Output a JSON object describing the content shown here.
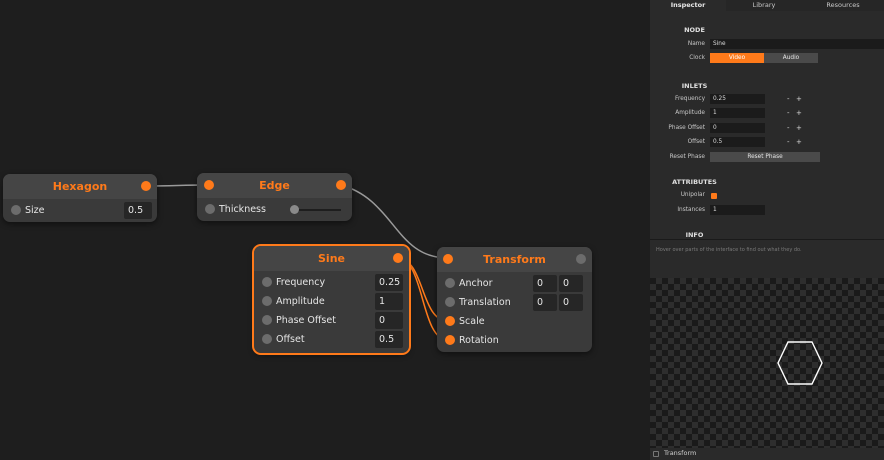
{
  "canvas": {
    "nodes": {
      "hexagon": {
        "title": "Hexagon",
        "inputs": [
          {
            "label": "Size",
            "value": "0.5"
          }
        ]
      },
      "edge": {
        "title": "Edge",
        "inputs": [
          {
            "label": "Thickness"
          }
        ]
      },
      "sine": {
        "title": "Sine",
        "inputs": [
          {
            "label": "Frequency",
            "value": "0.25"
          },
          {
            "label": "Amplitude",
            "value": "1"
          },
          {
            "label": "Phase Offset",
            "value": "0"
          },
          {
            "label": "Offset",
            "value": "0.5"
          }
        ]
      },
      "transform": {
        "title": "Transform",
        "inputs": [
          {
            "label": "Anchor",
            "x": "0",
            "y": "0"
          },
          {
            "label": "Translation",
            "x": "0",
            "y": "0"
          },
          {
            "label": "Scale"
          },
          {
            "label": "Rotation"
          }
        ]
      }
    }
  },
  "panel": {
    "tabs": [
      "Inspector",
      "Library",
      "Resources"
    ],
    "active_tab": "Inspector",
    "node_section": {
      "heading": "NODE",
      "name_label": "Name",
      "name_value": "Sine",
      "clock_label": "Clock",
      "clock_options": [
        "Video",
        "Audio"
      ],
      "clock_selected": "Video"
    },
    "inlets_section": {
      "heading": "INLETS",
      "rows": [
        {
          "label": "Frequency",
          "value": "0.25"
        },
        {
          "label": "Amplitude",
          "value": "1"
        },
        {
          "label": "Phase Offset",
          "value": "0"
        },
        {
          "label": "Offset",
          "value": "0.5"
        }
      ],
      "minus": "-",
      "plus": "+",
      "reset_label": "Reset Phase",
      "reset_button": "Reset Phase"
    },
    "attributes_section": {
      "heading": "ATTRIBUTES",
      "unipolar_label": "Unipolar",
      "unipolar_checked": true,
      "instances_label": "Instances",
      "instances_value": "1"
    },
    "info_section": {
      "heading": "INFO",
      "text": "Hover over parts of the interface to find out what they do."
    },
    "status": {
      "text": "Transform"
    }
  },
  "colors": {
    "accent": "#ff7a1a",
    "canvas_bg": "#1e1e1e",
    "node_bg": "#3a3a3a",
    "panel_bg": "#2a2a2a"
  }
}
